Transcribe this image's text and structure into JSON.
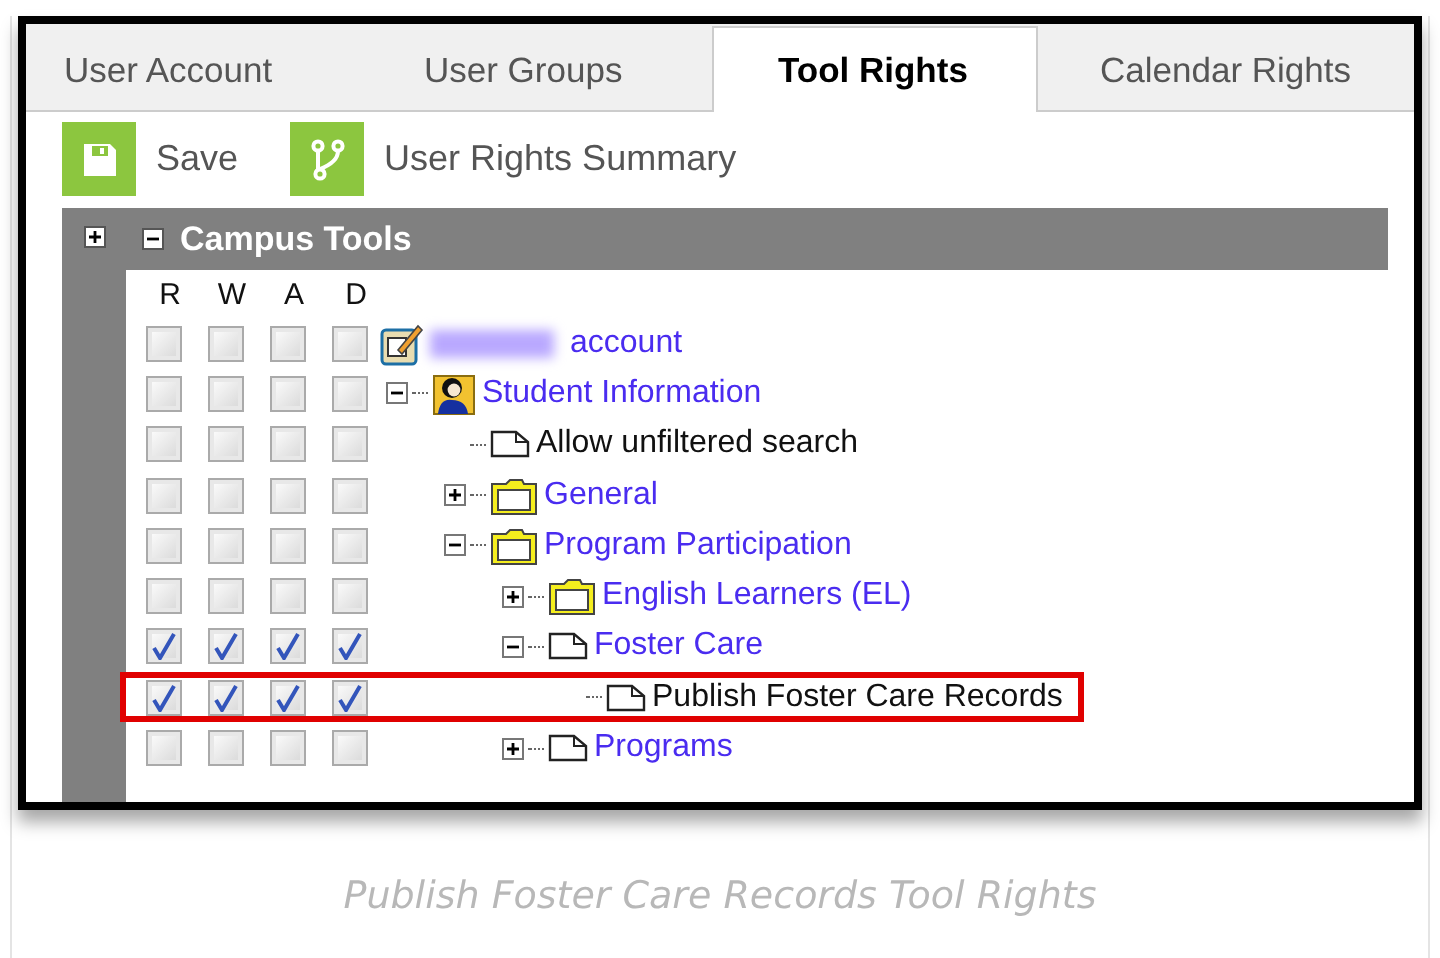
{
  "tabs": [
    {
      "label": "User Account",
      "selected": false
    },
    {
      "label": "User Groups",
      "selected": false
    },
    {
      "label": "Tool Rights",
      "selected": true
    },
    {
      "label": "Calendar Rights",
      "selected": false
    }
  ],
  "toolbar": [
    {
      "kind": "save",
      "label": "Save"
    },
    {
      "kind": "summary",
      "label": "User Rights Summary"
    }
  ],
  "panel": {
    "title": "Campus Tools",
    "expanded": true,
    "columns": [
      "R",
      "W",
      "A",
      "D"
    ],
    "tree": [
      {
        "label": "account",
        "kind": "edit",
        "link": true,
        "redacted_prefix": true,
        "checked": [
          false,
          false,
          false,
          false
        ],
        "children": [
          {
            "label": "Student Information",
            "kind": "person",
            "link": true,
            "expanded": true,
            "checked": [
              false,
              false,
              false,
              false
            ],
            "children": [
              {
                "label": "Allow unfiltered search",
                "kind": "page",
                "link": false,
                "checked": [
                  false,
                  false,
                  false,
                  false
                ]
              },
              {
                "label": "General",
                "kind": "folder",
                "link": true,
                "expanded": false,
                "checked": [
                  false,
                  false,
                  false,
                  false
                ]
              },
              {
                "label": "Program Participation",
                "kind": "folder",
                "link": true,
                "expanded": true,
                "checked": [
                  false,
                  false,
                  false,
                  false
                ],
                "children": [
                  {
                    "label": "English Learners (EL)",
                    "kind": "folder",
                    "link": true,
                    "expanded": false,
                    "checked": [
                      false,
                      false,
                      false,
                      false
                    ]
                  },
                  {
                    "label": "Foster Care",
                    "kind": "page",
                    "link": true,
                    "expanded": true,
                    "checked": [
                      true,
                      true,
                      true,
                      true
                    ],
                    "children": [
                      {
                        "label": "Publish Foster Care Records",
                        "kind": "page",
                        "link": false,
                        "highlighted": true,
                        "checked": [
                          true,
                          true,
                          true,
                          true
                        ]
                      }
                    ]
                  },
                  {
                    "label": "Programs",
                    "kind": "page",
                    "link": true,
                    "expanded": false,
                    "checked": [
                      false,
                      false,
                      false,
                      false
                    ]
                  }
                ]
              }
            ]
          }
        ]
      }
    ]
  },
  "caption": "Publish Foster Care Records Tool Rights"
}
